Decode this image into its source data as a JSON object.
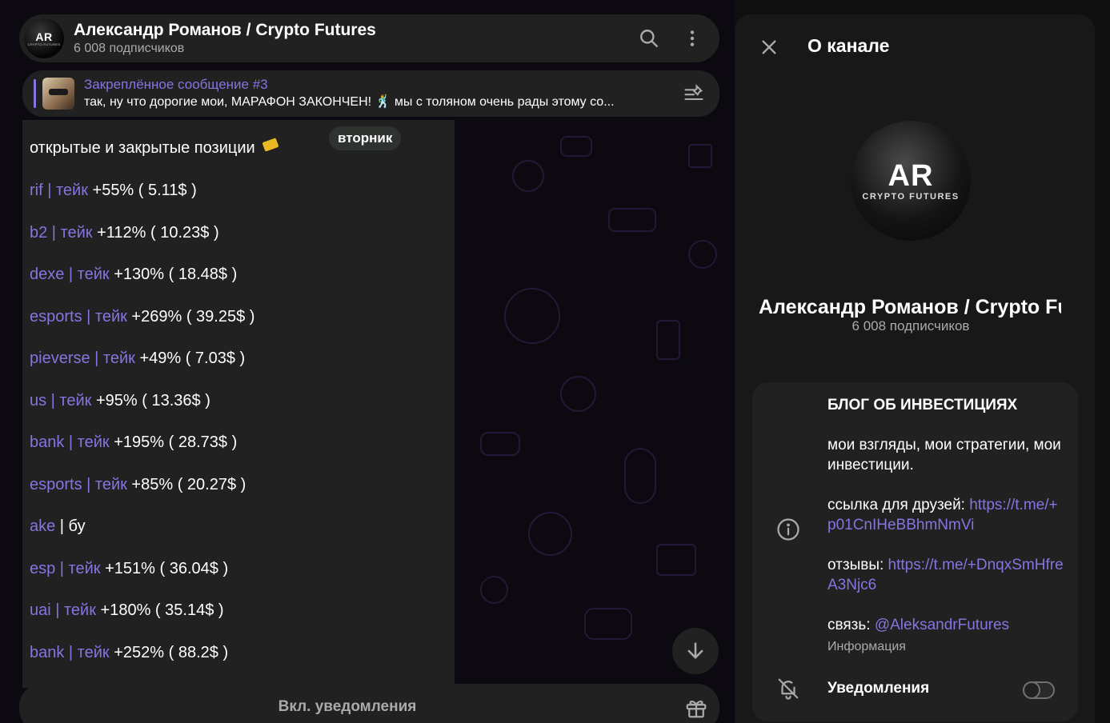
{
  "header": {
    "avatar_text": "AR",
    "avatar_subtext": "CRYPTO FUTURES",
    "title": "Александр Романов / Crypto Futures",
    "subtitle": "6 008 подписчиков",
    "search_icon": "search-icon",
    "menu_icon": "more-vertical-icon"
  },
  "pinned": {
    "title": "Закреплённое сообщение #3",
    "text": "так, ну что дорогие мои, МАРАФОН ЗАКОНЧЕН! 🕺 мы с толяном очень рады этому со...",
    "icon": "pin-list-icon"
  },
  "day_chip": "вторник",
  "message": {
    "header": "открытые и закрытые позиции",
    "lines": [
      {
        "ticker": "rif | тейк",
        "value": " +55% ( 5.11$ )"
      },
      {
        "ticker": " b2 | тейк",
        "value": " +112% ( 10.23$ )"
      },
      {
        "ticker": " dexe | тейк",
        "value": " +130% ( 18.48$ )"
      },
      {
        "ticker": "esports | тейк",
        "value": " +269% ( 39.25$ )"
      },
      {
        "ticker": "pieverse | тейк",
        "value": " +49% ( 7.03$ )"
      },
      {
        "ticker": "us | тейк",
        "value": " +95% ( 13.36$ )"
      },
      {
        "ticker": "bank | тейк",
        "value": " +195% ( 28.73$ )"
      },
      {
        "ticker": "esports | тейк",
        "value": " +85% ( 20.27$ )"
      },
      {
        "ticker": "ake",
        "value": " | бу"
      },
      {
        "ticker": "esp | тейк",
        "value": " +151% ( 36.04$ )"
      },
      {
        "ticker": "uai | тейк",
        "value": " +180% ( 35.14$ )"
      },
      {
        "ticker": "bank | тейк",
        "value": " +252% ( 88.2$ )"
      }
    ]
  },
  "bottom": {
    "unmute_label": "Вкл. уведомления",
    "gift_icon": "gift-icon",
    "scroll_icon": "arrow-down-icon"
  },
  "panel": {
    "title": "О канале",
    "avatar_text": "AR",
    "avatar_subtext": "CRYPTO FUTURES",
    "channel_name": "Александр Романов / Crypto Futures",
    "subscribers": "6 008 подписчиков",
    "info": {
      "heading": "БЛОГ ОБ ИНВЕСТИЦИЯХ",
      "description": "мои взгляды, мои стратегии, мои инвестиции.",
      "friends_label": "ссылка для друзей: ",
      "friends_link": "https://t.me/+p01CnIHeBBhmNmVi",
      "reviews_label": "отзывы: ",
      "reviews_link": "https://t.me/+DnqxSmHfreA3Njc6",
      "contact_label": "связь: ",
      "contact_link": "@AleksandrFutures",
      "caption": "Информация"
    },
    "notifications_label": "Уведомления",
    "notifications_enabled": false
  },
  "colors": {
    "accent": "#8774e1",
    "surface": "#212121",
    "panel": "#181818",
    "secondary_text": "#aaaaaa"
  }
}
